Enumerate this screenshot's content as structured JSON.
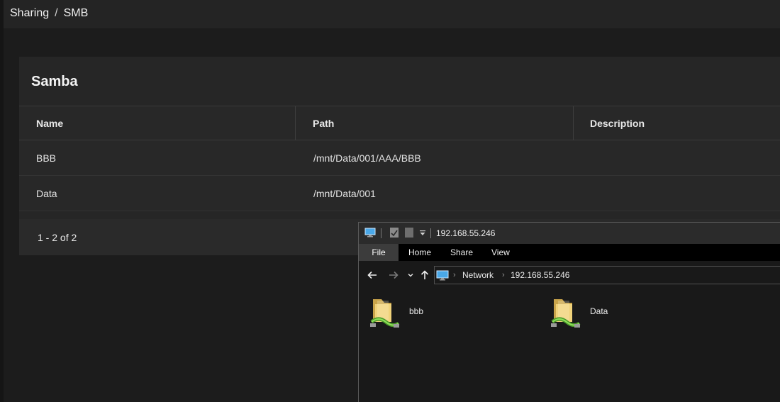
{
  "breadcrumb": {
    "parent": "Sharing",
    "separator": "/",
    "current": "SMB"
  },
  "card": {
    "title": "Samba",
    "columns": {
      "name": "Name",
      "path": "Path",
      "description": "Description"
    },
    "rows": [
      {
        "name": "BBB",
        "path": "/mnt/Data/001/AAA/BBB",
        "description": ""
      },
      {
        "name": "Data",
        "path": "/mnt/Data/001",
        "description": ""
      }
    ],
    "pagination": "1 - 2 of 2"
  },
  "explorer": {
    "title": "192.168.55.246",
    "ribbon_tabs": {
      "file": "File",
      "home": "Home",
      "share": "Share",
      "view": "View"
    },
    "address": {
      "network": "Network",
      "host": "192.168.55.246"
    },
    "shares": [
      {
        "name": "bbb"
      },
      {
        "name": "Data"
      }
    ],
    "colors": {
      "folder": "#e8c76a",
      "cable": "#6dbb3f"
    }
  },
  "theme": {
    "background": "#1c1c1c",
    "card": "#262626",
    "topbar": "#242424"
  }
}
